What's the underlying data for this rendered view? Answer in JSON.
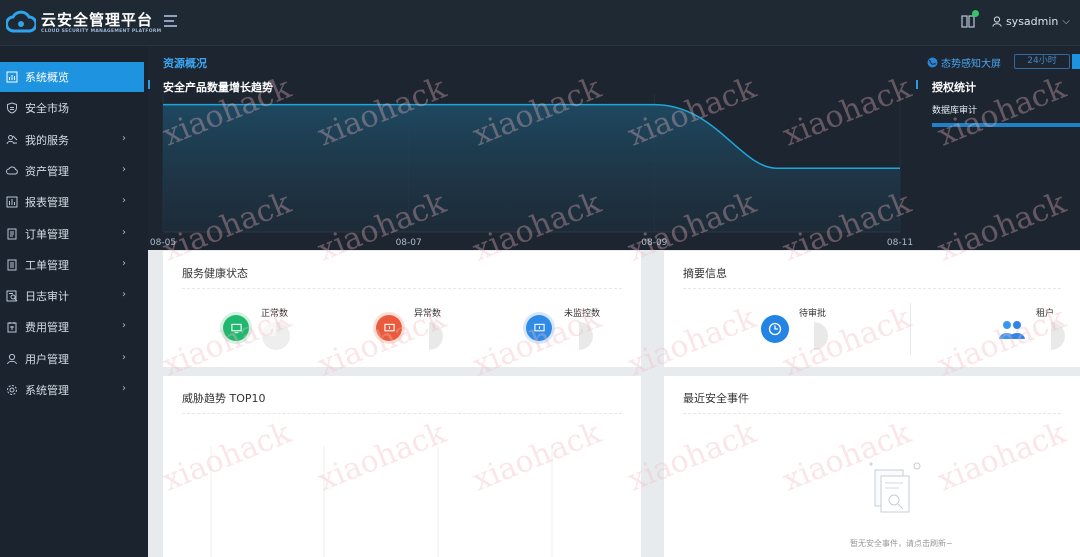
{
  "app": {
    "title": "云安全管理平台",
    "subtitle": "CLOUD SECURITY MANAGEMENT PLATFORM"
  },
  "header": {
    "username": "sysadmin",
    "notification_badge_color": "#37c26b"
  },
  "sidebar": {
    "items": [
      {
        "label": "系统概览",
        "icon": "chart-icon",
        "active": true,
        "has_arrow": false
      },
      {
        "label": "安全市场",
        "icon": "shield-icon",
        "active": false,
        "has_arrow": false
      },
      {
        "label": "我的服务",
        "icon": "service-icon",
        "active": false,
        "has_arrow": true
      },
      {
        "label": "资产管理",
        "icon": "cloud-icon",
        "active": false,
        "has_arrow": true
      },
      {
        "label": "报表管理",
        "icon": "report-icon",
        "active": false,
        "has_arrow": true
      },
      {
        "label": "订单管理",
        "icon": "order-icon",
        "active": false,
        "has_arrow": true
      },
      {
        "label": "工单管理",
        "icon": "ticket-icon",
        "active": false,
        "has_arrow": true
      },
      {
        "label": "日志审计",
        "icon": "audit-icon",
        "active": false,
        "has_arrow": true
      },
      {
        "label": "费用管理",
        "icon": "fee-icon",
        "active": false,
        "has_arrow": true
      },
      {
        "label": "用户管理",
        "icon": "user-icon",
        "active": false,
        "has_arrow": true
      },
      {
        "label": "系统管理",
        "icon": "gear-icon",
        "active": false,
        "has_arrow": true
      }
    ]
  },
  "overview": {
    "section_title": "资源概况",
    "bigscreen_label": "态势感知大屏",
    "time_range": "24小时"
  },
  "growth_chart": {
    "title": "安全产品数量增长趋势"
  },
  "chart_data": {
    "type": "area",
    "title": "安全产品数量增长趋势",
    "x": [
      "08-05",
      "08-07",
      "08-09",
      "08-11"
    ],
    "series": [
      {
        "values": [
          6,
          6,
          6,
          3
        ]
      }
    ],
    "ylim": [
      0,
      6.5
    ],
    "grid": false,
    "accent_color": "#1fa6d8"
  },
  "auth_stats": {
    "title": "授权统计",
    "items": [
      {
        "label": "数据库审计",
        "progress": 1.0
      }
    ]
  },
  "health": {
    "title": "服务健康状态",
    "stats": [
      {
        "label": "正常数",
        "color": "#1fb86e",
        "icon": "monitor-icon"
      },
      {
        "label": "异常数",
        "color": "#ea5b3d",
        "icon": "monitor-alert-icon"
      },
      {
        "label": "未监控数",
        "color": "#2f8be6",
        "icon": "monitor-off-icon"
      }
    ]
  },
  "summary": {
    "title": "摘要信息",
    "stats": [
      {
        "label": "待审批",
        "color": "#2484e5",
        "icon": "clock-icon"
      },
      {
        "label": "租户",
        "color": "#2484e5",
        "icon": "tenant-icon"
      }
    ]
  },
  "threats": {
    "title": "威胁趋势 TOP10"
  },
  "events": {
    "title": "最近安全事件",
    "empty_text": "暂无安全事件，请点击刷新~"
  }
}
